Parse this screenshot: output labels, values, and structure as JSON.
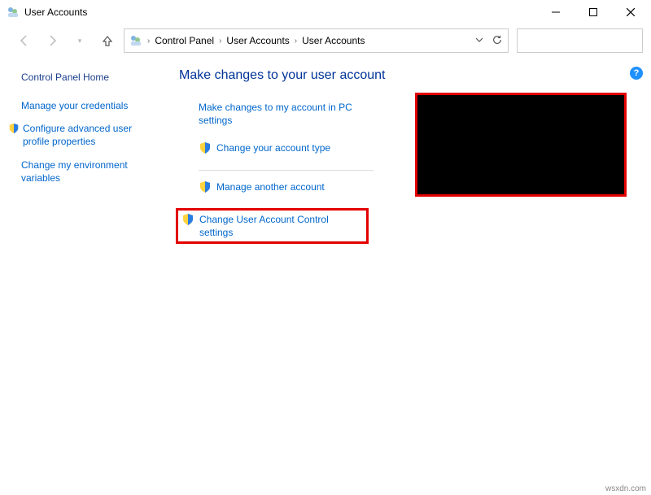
{
  "window": {
    "title": "User Accounts"
  },
  "breadcrumbs": {
    "item0": "Control Panel",
    "item1": "User Accounts",
    "item2": "User Accounts"
  },
  "search": {
    "placeholder": ""
  },
  "sidebar": {
    "home": "Control Panel Home",
    "links": {
      "l0": "Manage your credentials",
      "l1": "Configure advanced user profile properties",
      "l2": "Change my environment variables"
    }
  },
  "main": {
    "heading": "Make changes to your user account",
    "actions": {
      "a0": "Make changes to my account in PC settings",
      "a1": "Change your account type",
      "a2": "Manage another account",
      "a3": "Change User Account Control settings"
    }
  },
  "watermark": "wsxdn.com"
}
